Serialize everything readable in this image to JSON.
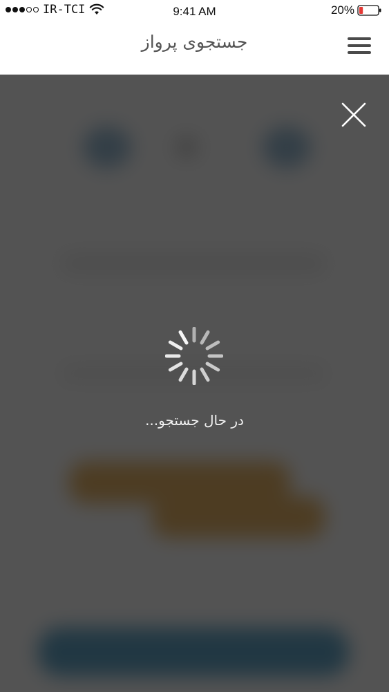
{
  "status_bar": {
    "carrier": "IR-TCI",
    "time": "9:41 AM",
    "battery": "20%",
    "signal_strength": 3,
    "signal_max": 5,
    "battery_level": 0.2,
    "icons": [
      "wifi-icon",
      "battery-icon"
    ]
  },
  "header": {
    "title": "جستجوی پرواز",
    "menu_icon": "hamburger-menu-icon"
  },
  "overlay": {
    "close_icon": "close-icon",
    "spinner_icon": "loading-spinner-icon",
    "loading_text": "در حال جستجو..."
  },
  "colors": {
    "overlay": "#3c3c3c",
    "header_text": "#555555",
    "battery_low": "#e53935",
    "blurred_accent_orange": "#c27a12",
    "blurred_accent_blue": "#0a5f8a"
  }
}
